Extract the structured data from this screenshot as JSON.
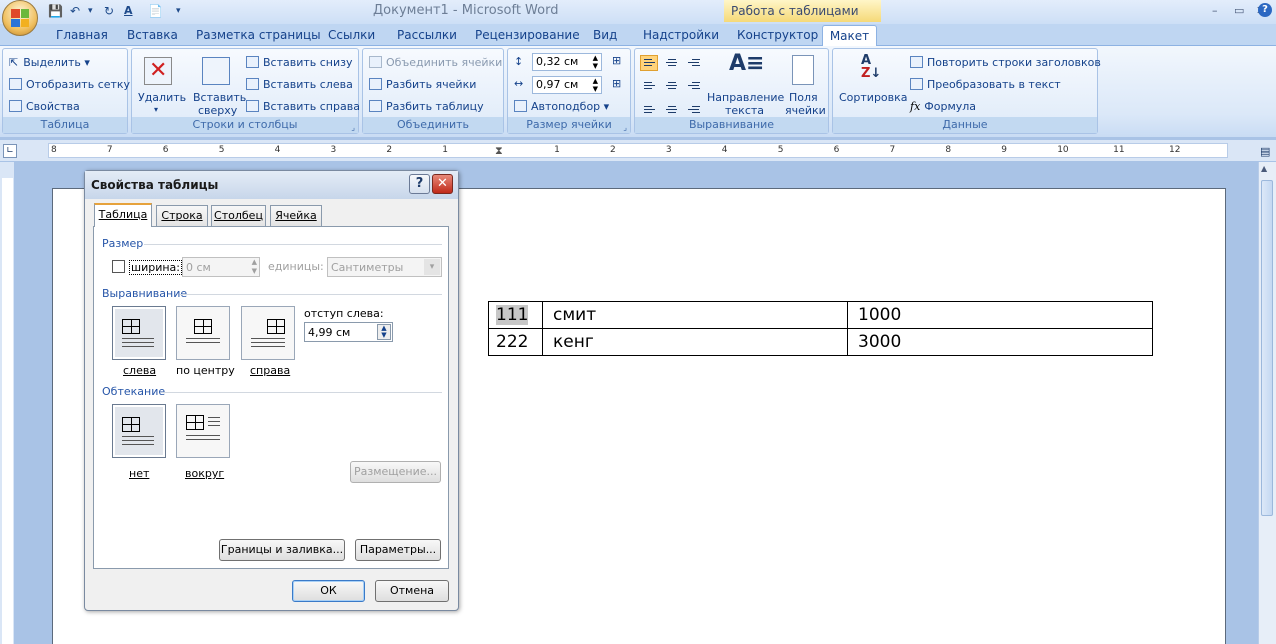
{
  "window": {
    "title": "Документ1 - Microsoft Word",
    "context_group": "Работа с таблицами",
    "controls": [
      "–",
      "▭",
      "✕"
    ]
  },
  "tabs": [
    "Главная",
    "Вставка",
    "Разметка страницы",
    "Ссылки",
    "Рассылки",
    "Рецензирование",
    "Вид",
    "Надстройки",
    "Конструктор",
    "Макет"
  ],
  "active_tab": "Макет",
  "ribbon": {
    "table_group": {
      "label": "Таблица",
      "select": "Выделить",
      "gridlines": "Отобразить сетку",
      "properties": "Свойства"
    },
    "rows_cols_group": {
      "label": "Строки и столбцы",
      "delete": "Удалить",
      "insert_above_1": "Вставить",
      "insert_above_2": "сверху",
      "insert_below": "Вставить снизу",
      "insert_left": "Вставить слева",
      "insert_right": "Вставить справа"
    },
    "merge_group": {
      "label": "Объединить",
      "merge_cells": "Объединить ячейки",
      "split_cells": "Разбить ячейки",
      "split_table": "Разбить таблицу"
    },
    "cell_size_group": {
      "label": "Размер ячейки",
      "height": "0,32 см",
      "width": "0,97 см",
      "autofit": "Автоподбор"
    },
    "alignment_group": {
      "label": "Выравнивание",
      "direction_1": "Направление",
      "direction_2": "текста",
      "margins_1": "Поля",
      "margins_2": "ячейки"
    },
    "data_group": {
      "label": "Данные",
      "sort": "Сортировка",
      "repeat_headers": "Повторить строки заголовков",
      "convert": "Преобразовать в текст",
      "formula": "Формула"
    }
  },
  "ruler_numbers": [
    "8",
    "7",
    "6",
    "5",
    "4",
    "3",
    "2",
    "1",
    "1",
    "2",
    "3",
    "4",
    "5",
    "6",
    "7",
    "8",
    "9",
    "10",
    "11",
    "12"
  ],
  "document_table": {
    "rows": [
      [
        "111",
        "смит",
        "1000"
      ],
      [
        "222",
        "кенг",
        "3000"
      ]
    ]
  },
  "dialog": {
    "title": "Свойства таблицы",
    "help": "?",
    "tabs": [
      "Таблица",
      "Строка",
      "Столбец",
      "Ячейка"
    ],
    "active_tab": "Таблица",
    "size_section": "Размер",
    "width_checkbox": "ширина:",
    "width_value": "0 см",
    "units_label": "единицы:",
    "units_value": "Сантиметры",
    "alignment_section": "Выравнивание",
    "align_left": "слева",
    "align_center": "по центру",
    "align_right": "справа",
    "indent_label": "отступ слева:",
    "indent_value": "4,99 см",
    "wrap_section": "Обтекание",
    "wrap_none": "нет",
    "wrap_around": "вокруг",
    "positioning": "Размещение...",
    "borders": "Границы и заливка...",
    "options": "Параметры...",
    "ok": "ОК",
    "cancel": "Отмена"
  }
}
